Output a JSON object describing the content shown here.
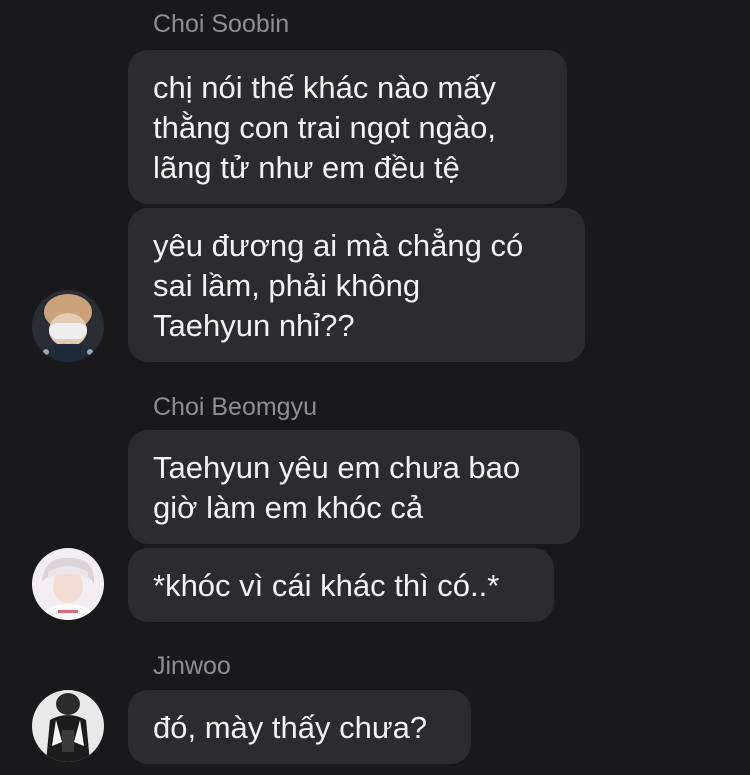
{
  "conversation": [
    {
      "sender": "Choi Soobin",
      "avatar_icon": "user-avatar-masked-icon",
      "messages": [
        {
          "lines": [
            "chị nói thế khác nào mấy",
            "thằng con trai ngọt ngào,",
            "lãng tử như em đều tệ"
          ]
        },
        {
          "lines": [
            "yêu đương ai mà chẳng có",
            "sai lầm, phải không",
            "Taehyun nhỉ??"
          ]
        }
      ]
    },
    {
      "sender": "Choi Beomgyu",
      "avatar_icon": "user-avatar-light-icon",
      "messages": [
        {
          "lines": [
            "Taehyun yêu em chưa bao",
            "giờ làm em khóc cả"
          ]
        },
        {
          "lines": [
            "*khóc vì cái khác thì có..*"
          ]
        }
      ]
    },
    {
      "sender": "Jinwoo",
      "avatar_icon": "user-avatar-dark-icon",
      "messages": [
        {
          "lines": [
            "đó, mày thấy chưa?"
          ]
        }
      ]
    }
  ],
  "colors": {
    "background": "#19191b",
    "bubble": "#2c2c2e",
    "message_text": "#f2f2f7",
    "sender_text": "#8e8e93"
  }
}
